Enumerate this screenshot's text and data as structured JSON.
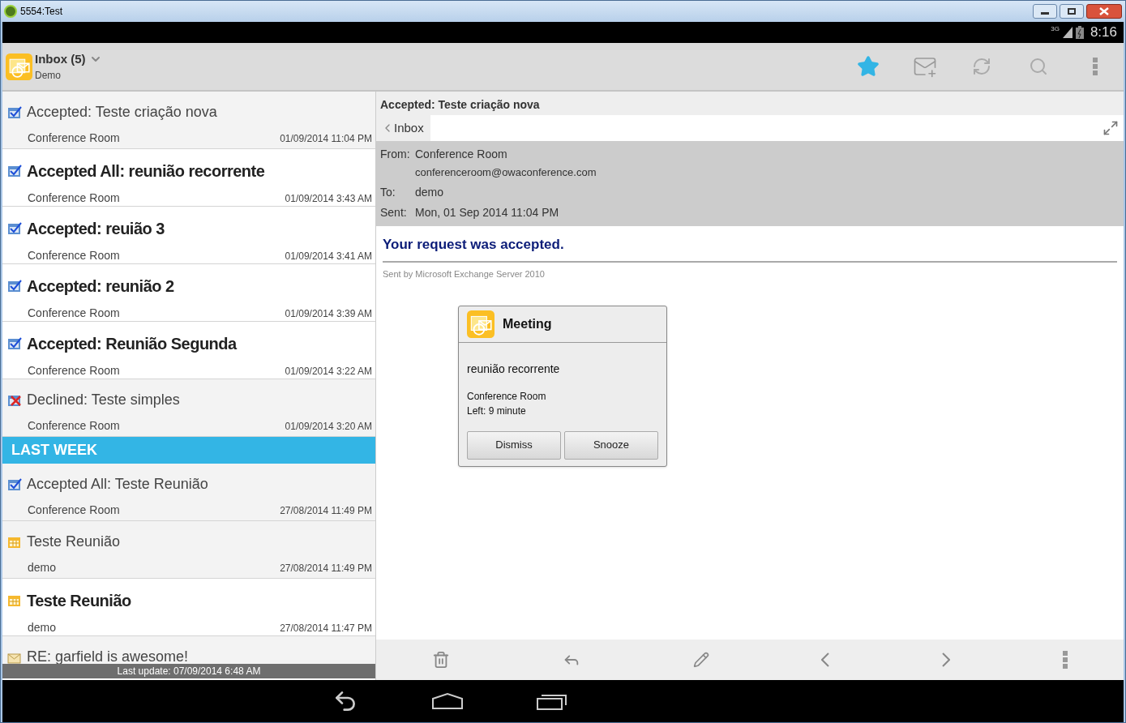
{
  "window": {
    "title": "5554:Test"
  },
  "status_bar": {
    "network": "3G",
    "time": "8:16"
  },
  "action_bar": {
    "title": "Inbox (5)",
    "subtitle": "Demo"
  },
  "messages": [
    {
      "kind": "accepted",
      "unread": false,
      "subject": "Accepted: Teste criação nova",
      "sender": "Conference Room",
      "date": "01/09/2014 11:04 PM"
    },
    {
      "kind": "accepted",
      "unread": true,
      "subject": "Accepted All: reunião recorrente",
      "sender": "Conference Room",
      "date": "01/09/2014 3:43 AM"
    },
    {
      "kind": "accepted",
      "unread": true,
      "subject": "Accepted: reuião 3",
      "sender": "Conference Room",
      "date": "01/09/2014 3:41 AM"
    },
    {
      "kind": "accepted",
      "unread": true,
      "subject": "Accepted: reunião 2",
      "sender": "Conference Room",
      "date": "01/09/2014 3:39 AM"
    },
    {
      "kind": "accepted",
      "unread": true,
      "subject": "Accepted: Reunião Segunda",
      "sender": "Conference Room",
      "date": "01/09/2014 3:22 AM"
    },
    {
      "kind": "declined",
      "unread": false,
      "subject": "Declined: Teste simples",
      "sender": "Conference Room",
      "date": "01/09/2014 3:20 AM"
    },
    {
      "kind": "section",
      "label": "LAST WEEK"
    },
    {
      "kind": "accepted",
      "unread": false,
      "subject": "Accepted All: Teste Reunião",
      "sender": "Conference Room",
      "date": "27/08/2014 11:49 PM"
    },
    {
      "kind": "meeting",
      "unread": false,
      "subject": "Teste Reunião",
      "sender": "demo",
      "date": "27/08/2014 11:49 PM"
    },
    {
      "kind": "meeting",
      "unread": true,
      "subject": "Teste Reunião",
      "sender": "demo",
      "date": "27/08/2014 11:47 PM"
    },
    {
      "kind": "reply",
      "unread": false,
      "subject": "RE: garfield is awesome!"
    }
  ],
  "last_update": "Last update: 07/09/2014 6:48 AM",
  "reader": {
    "subject": "Accepted: Teste criação nova",
    "back": "Inbox",
    "headers": [
      {
        "label": "From:",
        "value": "Conference Room",
        "extra": "conferenceroom@owaconference.com"
      },
      {
        "label": "To:",
        "value": "demo"
      },
      {
        "label": "Sent:",
        "value": "Mon, 01 Sep 2014 11:04 PM"
      }
    ],
    "heading": "Your request was accepted.",
    "footer": "Sent by Microsoft Exchange Server 2010"
  },
  "reminder": {
    "title": "Meeting",
    "subject": "reunião recorrente",
    "location": "Conference Room",
    "left": "Left: 9 minute",
    "buttons": [
      "Dismiss",
      "Snooze"
    ]
  }
}
